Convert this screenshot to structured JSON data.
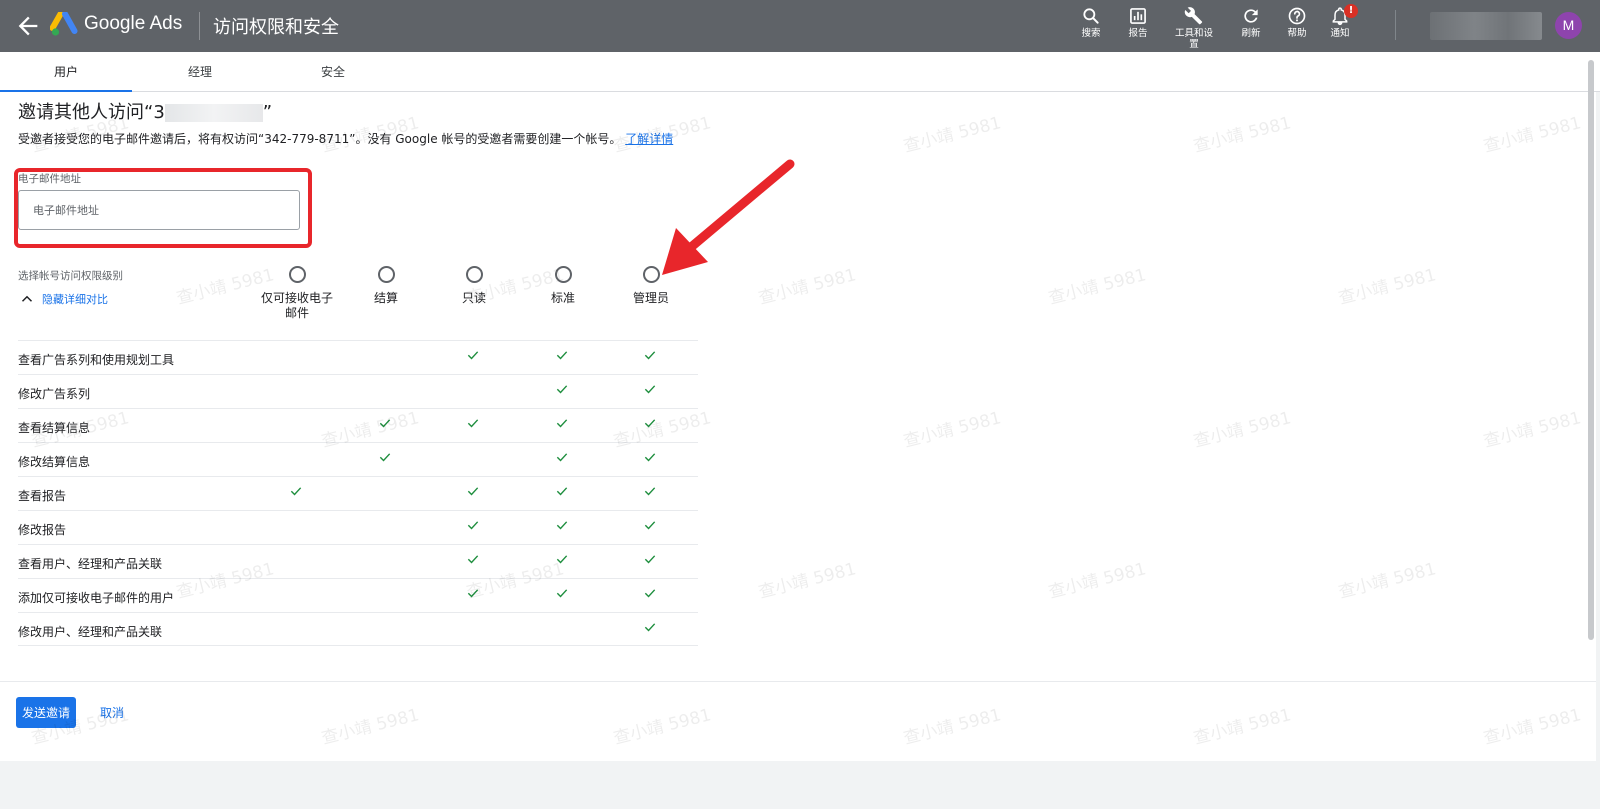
{
  "header": {
    "product_name": "Google Ads",
    "page_title": "访问权限和安全",
    "tools": [
      {
        "name": "search",
        "label": "搜索",
        "icon": "search-icon"
      },
      {
        "name": "reports",
        "label": "报告",
        "icon": "bar-chart-icon"
      },
      {
        "name": "tools-settings",
        "label": "工具和设置",
        "icon": "wrench-icon"
      },
      {
        "name": "refresh",
        "label": "刷新",
        "icon": "refresh-icon"
      },
      {
        "name": "help",
        "label": "帮助",
        "icon": "help-icon"
      },
      {
        "name": "notifications",
        "label": "通知",
        "icon": "bell-icon",
        "badge": "!"
      }
    ],
    "avatar_initial": "M",
    "avatar_color": "#8e44ad"
  },
  "tabs": [
    {
      "label": "用户",
      "active": true
    },
    {
      "label": "经理",
      "active": false
    },
    {
      "label": "安全",
      "active": false
    }
  ],
  "invite": {
    "title_prefix": "邀请其他人访问“3",
    "title_suffix": "”",
    "description": "受邀者接受您的电子邮件邀请后，将有权访问“342-779-8711”。没有 Google 帐号的受邀者需要创建一个帐号。",
    "learn_more": "了解详情",
    "email_label": "电子邮件地址",
    "email_placeholder": "电子邮件地址",
    "email_value": ""
  },
  "access": {
    "level_label": "选择帐号访问权限级别",
    "toggle_label": "隐藏详细对比",
    "roles": [
      {
        "key": "email-only",
        "label": "仅可接收电子邮件"
      },
      {
        "key": "billing",
        "label": "结算"
      },
      {
        "key": "read-only",
        "label": "只读"
      },
      {
        "key": "standard",
        "label": "标准"
      },
      {
        "key": "admin",
        "label": "管理员"
      }
    ],
    "permissions": [
      {
        "label": "查看广告系列和使用规划工具",
        "checks": [
          false,
          false,
          true,
          true,
          true
        ]
      },
      {
        "label": "修改广告系列",
        "checks": [
          false,
          false,
          false,
          true,
          true
        ]
      },
      {
        "label": "查看结算信息",
        "checks": [
          false,
          true,
          true,
          true,
          true
        ]
      },
      {
        "label": "修改结算信息",
        "checks": [
          false,
          true,
          false,
          true,
          true
        ]
      },
      {
        "label": "查看报告",
        "checks": [
          true,
          false,
          true,
          true,
          true
        ]
      },
      {
        "label": "修改报告",
        "checks": [
          false,
          false,
          true,
          true,
          true
        ]
      },
      {
        "label": "查看用户、经理和产品关联",
        "checks": [
          false,
          false,
          true,
          true,
          true
        ]
      },
      {
        "label": "添加仅可接收电子邮件的用户",
        "checks": [
          false,
          false,
          true,
          true,
          true
        ]
      },
      {
        "label": "修改用户、经理和产品关联",
        "checks": [
          false,
          false,
          false,
          false,
          true
        ]
      }
    ]
  },
  "actions": {
    "send_label": "发送邀请",
    "cancel_label": "取消"
  },
  "watermark_text": "查小靖 5981",
  "colors": {
    "header_bg": "#5f6368",
    "accent": "#1a73e8",
    "check": "#1e8e3e",
    "highlight": "#e8262b"
  }
}
